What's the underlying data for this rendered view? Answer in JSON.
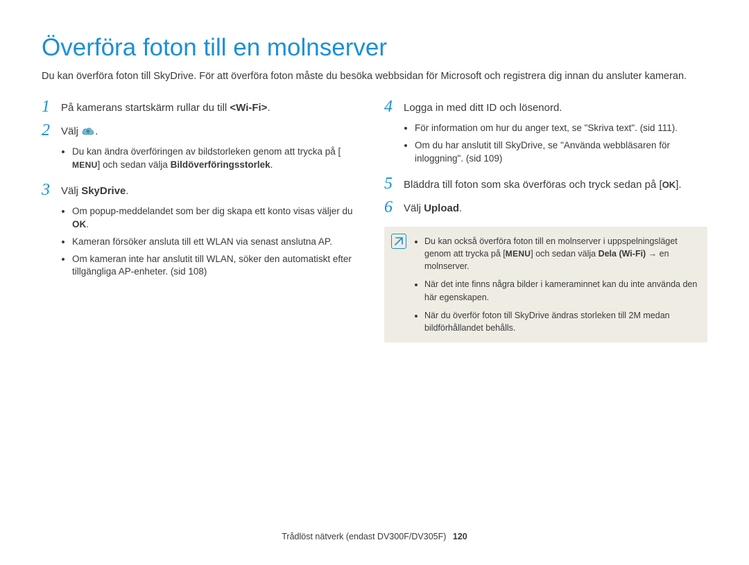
{
  "title": "Överföra foton till en molnserver",
  "intro": "Du kan överföra foton till SkyDrive. För att överföra foton måste du besöka webbsidan för Microsoft och registrera dig innan du ansluter kameran.",
  "left": {
    "step1": {
      "num": "1",
      "text_pre": "På kamerans startskärm rullar du till ",
      "bold": "<Wi-Fi>",
      "text_post": "."
    },
    "step2": {
      "num": "2",
      "text_pre": "Välj ",
      "text_post": "."
    },
    "step2_bullets": [
      {
        "pre": "Du kan ändra överföringen av bildstorleken genom att trycka på [",
        "key": "MENU",
        "mid": "] och sedan välja ",
        "bold": "Bildöverföringsstorlek",
        "post": "."
      }
    ],
    "step3": {
      "num": "3",
      "text_pre": "Välj ",
      "bold": "SkyDrive",
      "text_post": "."
    },
    "step3_bullets": [
      {
        "pre": "Om popup-meddelandet som ber dig skapa ett konto visas väljer du ",
        "bold": "OK",
        "post": "."
      },
      {
        "text": "Kameran försöker ansluta till ett WLAN via senast anslutna AP."
      },
      {
        "text": "Om kameran inte har anslutit till WLAN, söker den automatiskt efter tillgängliga AP-enheter. (sid 108)"
      }
    ]
  },
  "right": {
    "step4": {
      "num": "4",
      "text": "Logga in med ditt ID och lösenord."
    },
    "step4_bullets": [
      {
        "text": "För information om hur du anger text, se \"Skriva text\". (sid 111)."
      },
      {
        "text": "Om du har anslutit till SkyDrive, se \"Använda webbläsaren för inloggning\". (sid 109)"
      }
    ],
    "step5": {
      "num": "5",
      "text_pre": "Bläddra till foton som ska överföras och tryck sedan på [",
      "key": "OK",
      "text_post": "]."
    },
    "step6": {
      "num": "6",
      "text_pre": "Välj ",
      "bold": "Upload",
      "text_post": "."
    },
    "notes": [
      {
        "pre": "Du kan också överföra foton till en molnserver i uppspelningsläget genom att trycka på [",
        "key": "MENU",
        "mid": "] och sedan välja ",
        "bold": "Dela (Wi-Fi)",
        "arrow": " → ",
        "post": "en molnserver."
      },
      {
        "text": "När det inte finns några bilder i kameraminnet kan du inte använda den här egenskapen."
      },
      {
        "text": "När du överför foton till SkyDrive ändras storleken till 2M medan bildförhållandet behålls."
      }
    ]
  },
  "footer": {
    "text": "Trådlöst nätverk (endast DV300F/DV305F)",
    "page": "120"
  }
}
